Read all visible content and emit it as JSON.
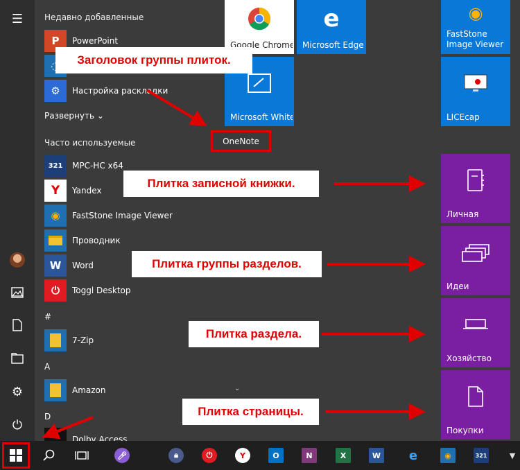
{
  "app_list": {
    "recent_header": "Недавно добавленные",
    "recent": [
      {
        "label": "PowerPoint",
        "icon": "powerpoint-icon",
        "color": "#d24726",
        "glyph": "P"
      },
      {
        "label": "Настройка раскладки",
        "icon": "settings-app-icon",
        "color": "#2b6bd6",
        "glyph": "⚙"
      }
    ],
    "expand_label": "Развернуть",
    "frequent_header": "Часто используемые",
    "frequent": [
      {
        "label": "MPC-HC x64",
        "icon": "mpc-hc-icon",
        "color": "#1c3f7a",
        "glyph": "321"
      },
      {
        "label": "Yandex",
        "icon": "yandex-icon",
        "color": "#ffffff",
        "glyph": "Y"
      },
      {
        "label": "FastStone Image Viewer",
        "icon": "faststone-icon",
        "color": "#1f6fb3",
        "glyph": "◉"
      },
      {
        "label": "Проводник",
        "icon": "explorer-icon",
        "color": "#f1c232",
        "glyph": "▭"
      },
      {
        "label": "Word",
        "icon": "word-icon",
        "color": "#2b579a",
        "glyph": "W"
      },
      {
        "label": "Toggl Desktop",
        "icon": "toggl-icon",
        "color": "#e01b22",
        "glyph": "⏻"
      }
    ],
    "letter_hash": "#",
    "app_7zip": "7-Zip",
    "letter_a": "A",
    "app_amazon": "Amazon",
    "letter_d": "D",
    "app_dolby": "Dolby Access"
  },
  "tiles": {
    "chrome": "Google Chrome",
    "edge": "Microsoft Edge",
    "faststone": "FastStone Image Viewer",
    "whiteboard": "Microsoft Whiteboard",
    "licecap": "LICEcap",
    "group_title": "OneNote",
    "notebook": "Личная",
    "section_group": "Идеи",
    "section": "Хозяйство",
    "page": "Покупки"
  },
  "callouts": {
    "group_title": "Заголовок группы плиток.",
    "notebook": "Плитка записной книжки.",
    "section_group": "Плитка группы разделов.",
    "section": "Плитка раздела.",
    "page": "Плитка страницы."
  },
  "colors": {
    "accent_blue": "#0a78d7",
    "onenote_purple": "#7b1fa2",
    "annotation_red": "#e10000",
    "taskbar": "#1f1f1f"
  },
  "taskbar": {
    "icons": [
      "start-icon",
      "search-icon",
      "task-view-icon",
      "cortana-icon",
      "keepass-icon",
      "toggl-icon",
      "yandex-icon",
      "outlook-icon",
      "onenote-icon",
      "excel-icon",
      "word-icon",
      "edge-icon",
      "faststone-icon",
      "mpc-hc-icon",
      "fox-icon"
    ]
  }
}
